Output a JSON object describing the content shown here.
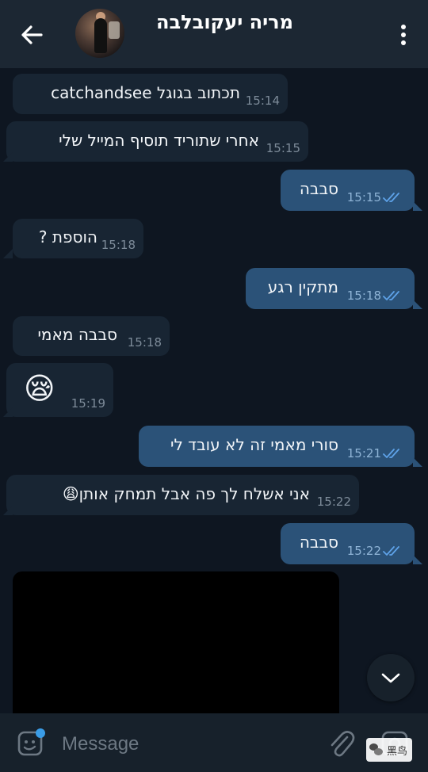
{
  "header": {
    "contact_name": "מריה יעקובלבה",
    "back_icon": "arrow-left-icon",
    "menu_icon": "more-vertical-icon"
  },
  "messages": [
    {
      "direction": "in",
      "text": "תכתוב בגוגל catchandsee",
      "time": "15:14"
    },
    {
      "direction": "in",
      "text": "אחרי שתוריד תוסיף המייל שלי",
      "time": "15:15"
    },
    {
      "direction": "out",
      "text": "סבבה",
      "time": "15:15",
      "read": true
    },
    {
      "direction": "in",
      "text": "הוספת ?",
      "time": "15:18"
    },
    {
      "direction": "out",
      "text": "מתקין רגע",
      "time": "15:18",
      "read": true
    },
    {
      "direction": "in",
      "text": "סבבה מאמי",
      "time": "15:18"
    },
    {
      "direction": "in",
      "text": "😪",
      "time": "15:19"
    },
    {
      "direction": "out",
      "text": "סורי מאמי זה לא עובד לי",
      "time": "15:21",
      "read": true
    },
    {
      "direction": "in",
      "text": "אני אשלח לך פה אבל תמחק אותן😩",
      "time": "15:22"
    },
    {
      "direction": "out",
      "text": "סבבה",
      "time": "15:22",
      "read": true
    }
  ],
  "composer": {
    "placeholder": "Message",
    "sticker_icon": "sticker-icon",
    "attach_icon": "paperclip-icon",
    "camera_icon": "camera-icon"
  },
  "watermark": {
    "text": "黑鸟"
  },
  "colors": {
    "background": "#0e1621",
    "header": "#1c2733",
    "incoming_bubble": "#182533",
    "outgoing_bubble": "#2b5278",
    "read_check": "#5ea2e8"
  }
}
